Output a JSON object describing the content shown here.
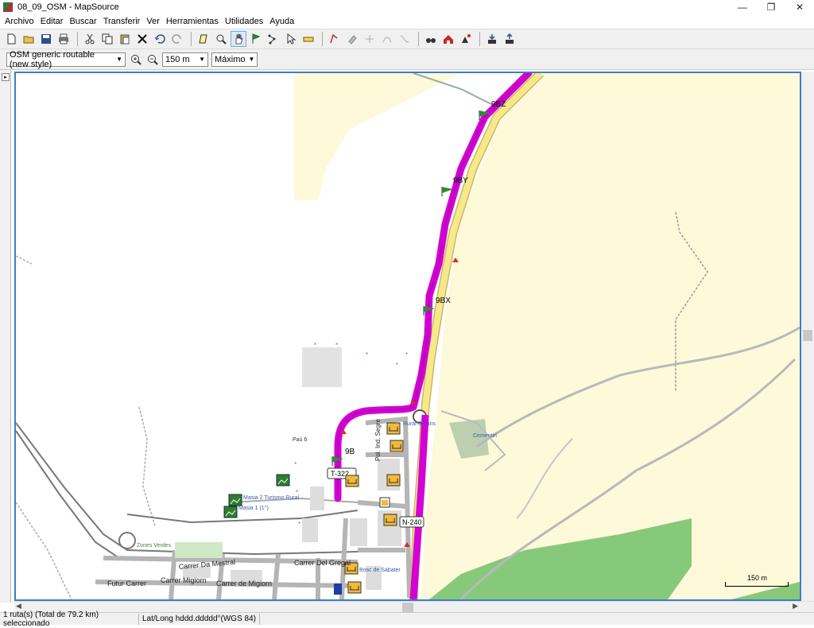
{
  "window": {
    "title": "08_09_OSM - MapSource",
    "buttons": {
      "minimize": "—",
      "restore": "❐",
      "close": "✕"
    }
  },
  "menu": [
    "Archivo",
    "Editar",
    "Buscar",
    "Transferir",
    "Ver",
    "Herramientas",
    "Utilidades",
    "Ayuda"
  ],
  "toolbar2": {
    "map_select": "OSM generic routable (new style)",
    "scale_select": "150 m",
    "detail_select": "Máximo"
  },
  "map": {
    "waypoints": [
      "9BZ",
      "9BY",
      "9BX",
      "9B"
    ],
    "road_badges": [
      "T-322",
      "N-240"
    ],
    "streets": [
      "Carrer Da Mestral",
      "Carrer Del Gregal",
      "Carrer Migiorn",
      "Carrer de Migiorn",
      "Futur Carrer",
      "Pol. Ind. Segre"
    ],
    "pois": [
      "Paú 6",
      "Rural Sàrans",
      "Zones Verdes",
      "Cementiri",
      "Bosc de Sabater",
      "Masia 2 Turismo Rural",
      "Masia 1 (1°)"
    ],
    "scale_label": "150 m",
    "colors": {
      "route": "#d400d4",
      "land": "#fdf9d9",
      "forest": "#86c97a"
    }
  },
  "status": {
    "selection": "1 ruta(s) (Total de 79.2 km) seleccionado",
    "coords": "Lat/Long hddd.ddddd°(WGS 84)"
  }
}
